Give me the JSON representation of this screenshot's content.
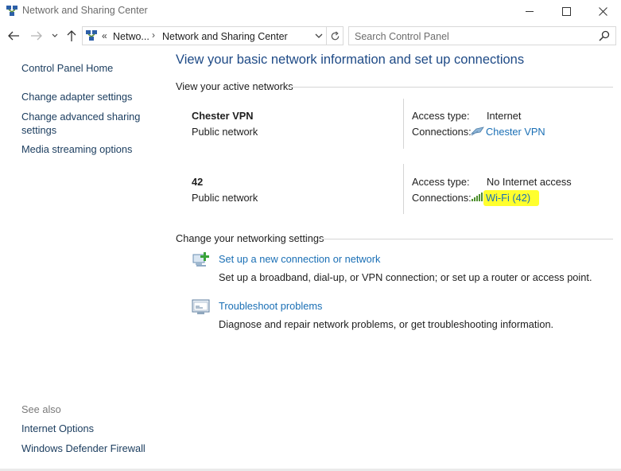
{
  "window": {
    "title": "Network and Sharing Center"
  },
  "address": {
    "overflow": "«",
    "segment1": "Netwo...",
    "separator": "›",
    "segment2": "Network and Sharing Center"
  },
  "search": {
    "placeholder": "Search Control Panel"
  },
  "sidebar": {
    "home": "Control Panel Home",
    "items": [
      "Change adapter settings",
      "Change advanced sharing settings",
      "Media streaming options"
    ],
    "see_also_label": "See also",
    "see_also": [
      "Internet Options",
      "Windows Defender Firewall"
    ]
  },
  "main": {
    "title": "View your basic network information and set up connections",
    "active_networks_header": "View your active networks",
    "networks": [
      {
        "name": "Chester VPN",
        "category": "Public network",
        "access_type_label": "Access type:",
        "access_type": "Internet",
        "connections_label": "Connections:",
        "connection": "Chester VPN",
        "connection_icon": "vpn-icon"
      },
      {
        "name": "42",
        "category": "Public network",
        "access_type_label": "Access type:",
        "access_type": "No Internet access",
        "connections_label": "Connections:",
        "connection": "Wi-Fi (42)",
        "connection_icon": "wifi-signal-icon"
      }
    ],
    "settings_header": "Change your networking settings",
    "tasks": [
      {
        "link": "Set up a new connection or network",
        "description": "Set up a broadband, dial-up, or VPN connection; or set up a router or access point.",
        "icon": "new-connection-icon"
      },
      {
        "link": "Troubleshoot problems",
        "description": "Diagnose and repair network problems, or get troubleshooting information.",
        "icon": "troubleshoot-icon"
      }
    ]
  },
  "colors": {
    "link": "#1a6fb5",
    "nav_link": "#1a3c5e",
    "title": "#1e4a86",
    "highlight": "#ffff2e"
  }
}
